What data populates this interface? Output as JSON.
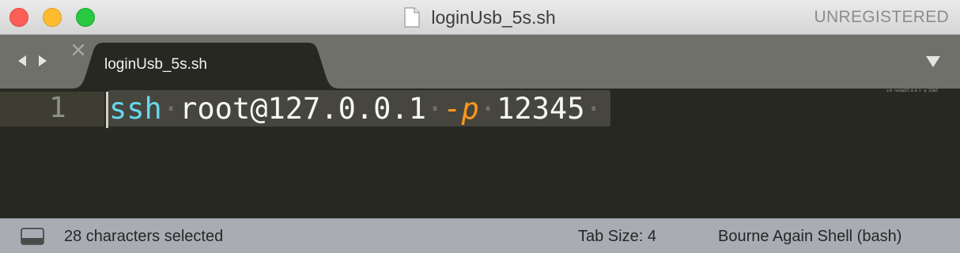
{
  "window": {
    "title": "loginUsb_5s.sh",
    "registration": "UNREGISTERED"
  },
  "tabs": [
    {
      "label": "loginUsb_5s.sh",
      "active": true
    }
  ],
  "editor": {
    "line_number": "1",
    "code": {
      "command": "ssh",
      "target": "root@127.0.0.1",
      "flag": "-p",
      "port": "12345",
      "space_marker": "·"
    },
    "minimap_text": "ssh root@127.0.0.1 -p 12345"
  },
  "status": {
    "selection": "28 characters selected",
    "tab_size": "Tab Size: 4",
    "syntax": "Bourne Again Shell (bash)"
  },
  "colors": {
    "background": "#272822",
    "command": "#66d9ef",
    "flag": "#fd971f",
    "text": "#f8f8f2"
  },
  "icons": [
    "file-icon",
    "back-arrow-icon",
    "forward-arrow-icon",
    "close-icon",
    "tab-menu-icon",
    "panel-toggle-icon"
  ]
}
